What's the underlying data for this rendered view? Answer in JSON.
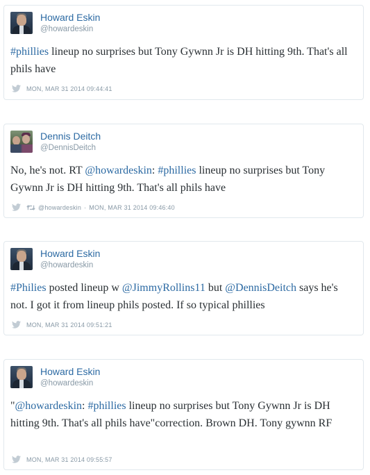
{
  "colors": {
    "link": "#2c6aa3",
    "text": "#292f33",
    "meta": "#8899a6",
    "border": "#e1e8ed"
  },
  "tweets": [
    {
      "author": "Howard Eskin",
      "handle": "@howardeskin",
      "avatar_icon": "howard-eskin-avatar",
      "text_parts": [
        "#phillies",
        " lineup no surprises but Tony Gywnn Jr is DH hitting 9th. That's all phils have"
      ],
      "timestamp": "MON, MAR 31 2014 09:44:41"
    },
    {
      "author": "Dennis Deitch",
      "handle": "@DennisDeitch",
      "avatar_icon": "dennis-deitch-avatar",
      "text_parts": [
        "No, he's not. RT ",
        "@howardeskin",
        ": ",
        "#phillies",
        " lineup no surprises but Tony Gywnn Jr is DH hitting 9th. That's all phils have"
      ],
      "retweet_of": "@howardeskin",
      "timestamp": "MON, MAR 31 2014 09:46:40"
    },
    {
      "author": "Howard Eskin",
      "handle": "@howardeskin",
      "avatar_icon": "howard-eskin-avatar",
      "text_parts": [
        "#Philies",
        " posted lineup w ",
        "@JimmyRollins11",
        " but ",
        "@DennisDeitch",
        " says he's not. I got it from lineup phils posted. If so typical phillies"
      ],
      "timestamp": "MON, MAR 31 2014 09:51:21"
    },
    {
      "author": "Howard Eskin",
      "handle": "@howardeskin",
      "avatar_icon": "howard-eskin-avatar",
      "text_parts": [
        "\"",
        "@howardeskin",
        ": ",
        "#phillies",
        " lineup no surprises but Tony Gywnn Jr is DH hitting 9th. That's all phils have\"correction. Brown DH. Tony gywnn RF"
      ],
      "timestamp": "MON, MAR 31 2014 09:55:57"
    }
  ]
}
